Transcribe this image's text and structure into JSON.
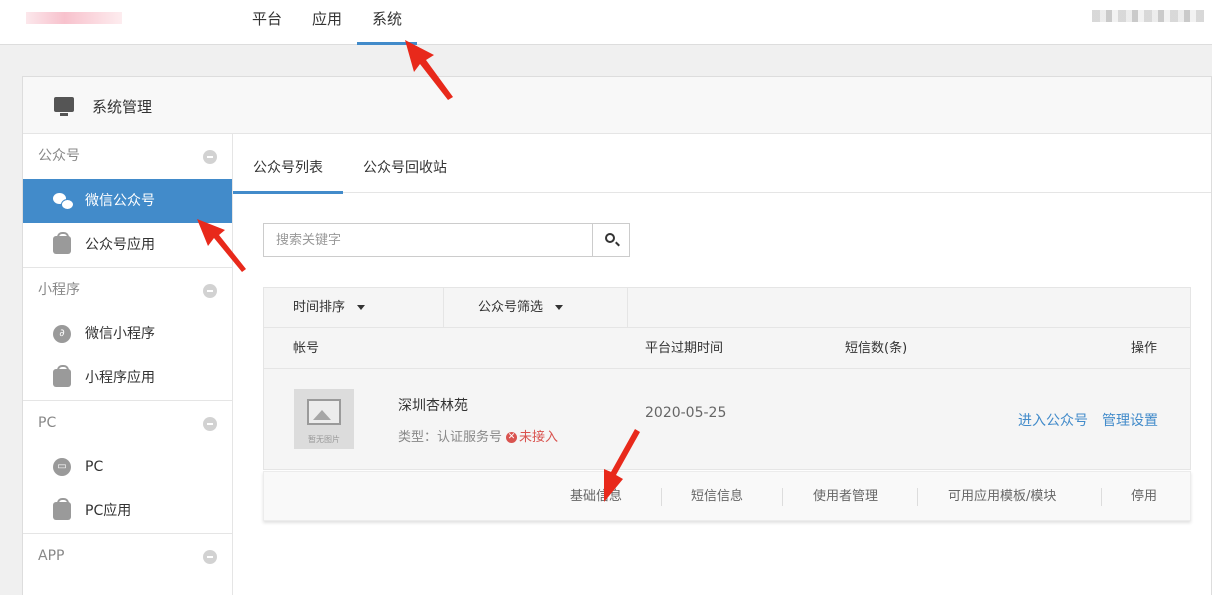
{
  "top_nav": {
    "items": [
      {
        "label": "平台"
      },
      {
        "label": "应用"
      },
      {
        "label": "系统"
      }
    ],
    "active": "系统"
  },
  "panel": {
    "title": "系统管理"
  },
  "sidebar": {
    "sections": [
      {
        "title": "公众号",
        "items": [
          {
            "label": "微信公众号",
            "icon": "wechat-icon"
          },
          {
            "label": "公众号应用",
            "icon": "app-bag-icon"
          }
        ]
      },
      {
        "title": "小程序",
        "items": [
          {
            "label": "微信小程序",
            "icon": "mini-program-icon"
          },
          {
            "label": "小程序应用",
            "icon": "app-bag-icon"
          }
        ]
      },
      {
        "title": "PC",
        "items": [
          {
            "label": "PC",
            "icon": "pc-icon"
          },
          {
            "label": "PC应用",
            "icon": "app-bag-icon"
          }
        ]
      },
      {
        "title": "APP",
        "items": []
      }
    ],
    "active": "微信公众号"
  },
  "tabs": [
    {
      "label": "公众号列表"
    },
    {
      "label": "公众号回收站"
    }
  ],
  "search": {
    "placeholder": "搜索关键字"
  },
  "filters": {
    "sort": "时间排序",
    "account_filter": "公众号筛选"
  },
  "table": {
    "columns": {
      "account": "帐号",
      "expire": "平台过期时间",
      "sms": "短信数(条)",
      "ops": "操作"
    },
    "rows": [
      {
        "thumb_caption": "暂无图片",
        "name": "深圳杏林苑",
        "type_label": "类型：",
        "type": "认证服务号",
        "status": "未接入",
        "expire": "2020-05-25",
        "actions": {
          "enter": "进入公众号",
          "manage": "管理设置"
        }
      }
    ]
  },
  "action_bar": {
    "items": [
      "基础信息",
      "短信信息",
      "使用者管理",
      "可用应用模板/模块",
      "停用"
    ]
  },
  "colors": {
    "accent": "#428bca",
    "danger": "#d9534f",
    "annotation": "#e8291b"
  }
}
